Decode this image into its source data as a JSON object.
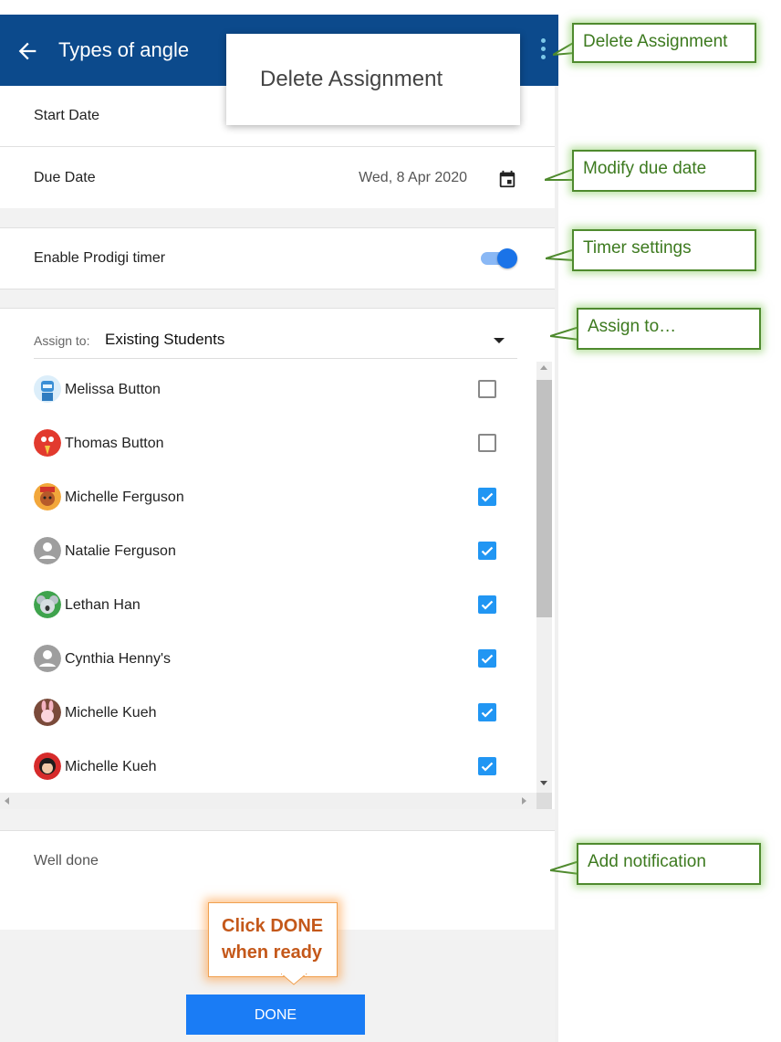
{
  "header": {
    "title": "Types of angle",
    "back_icon": "arrow-left-icon",
    "menu_icon": "more-vert-icon"
  },
  "menu": {
    "items": [
      "Delete Assignment"
    ]
  },
  "dates": {
    "start_label": "Start Date",
    "due_label": "Due Date",
    "due_value": "Wed, 8 Apr 2020",
    "calendar_icon": "calendar-icon"
  },
  "timer": {
    "label": "Enable Prodigi timer",
    "enabled": true
  },
  "assign": {
    "label": "Assign to:",
    "value": "Existing Students"
  },
  "students": [
    {
      "name": "Melissa Button",
      "checked": false,
      "avatar": "robot-avatar"
    },
    {
      "name": "Thomas Button",
      "checked": false,
      "avatar": "red-creature-avatar"
    },
    {
      "name": "Michelle Ferguson",
      "checked": true,
      "avatar": "lion-avatar"
    },
    {
      "name": "Natalie Ferguson",
      "checked": true,
      "avatar": "default-person-avatar"
    },
    {
      "name": "Lethan Han",
      "checked": true,
      "avatar": "koala-avatar"
    },
    {
      "name": "Cynthia Henny's",
      "checked": true,
      "avatar": "default-person-avatar"
    },
    {
      "name": "Michelle Kueh",
      "checked": true,
      "avatar": "bunny-avatar"
    },
    {
      "name": "Michelle Kueh",
      "checked": true,
      "avatar": "girl-avatar"
    }
  ],
  "notification": {
    "text": "Well done"
  },
  "done_button": {
    "label": "DONE"
  },
  "callouts": {
    "delete": "Delete Assignment",
    "due": "Modify due date",
    "timer": "Timer settings",
    "assign": "Assign to…",
    "notify": "Add notification",
    "done_line1": "Click DONE",
    "done_line2": "when ready"
  },
  "colors": {
    "header_bg": "#0c4a8c",
    "checkbox_on": "#2196f3",
    "done_button": "#1a7cf5",
    "callout_green": "#4f8a2e",
    "callout_orange": "#c4581a"
  }
}
